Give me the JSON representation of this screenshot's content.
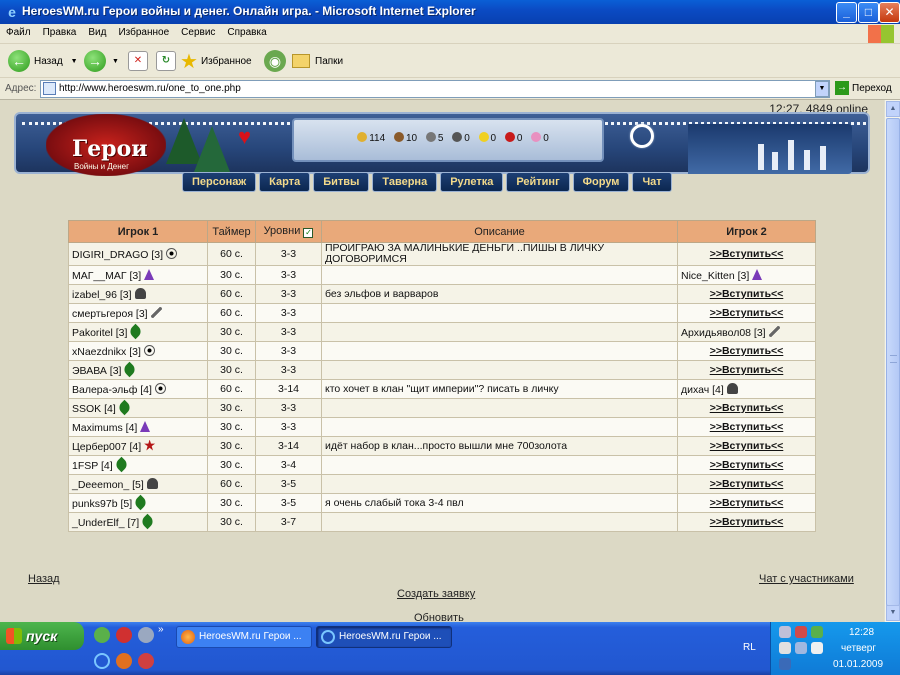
{
  "window": {
    "title": "HeroesWM.ru Герои войны и денег. Онлайн игра. - Microsoft Internet Explorer",
    "controls": {
      "minimize": "_",
      "maximize": "□",
      "close": "✕"
    }
  },
  "menu": [
    "Файл",
    "Правка",
    "Вид",
    "Избранное",
    "Сервис",
    "Справка"
  ],
  "toolbar": {
    "back": "Назад",
    "favorites": "Избранное",
    "folders": "Папки"
  },
  "address": {
    "label": "Адрес:",
    "url": "http://www.heroeswm.ru/one_to_one.php",
    "go": "Переход"
  },
  "game": {
    "online": "12:27, 4849 online",
    "logo": "Герои",
    "logo_sub": "Войны и Денег",
    "resources": [
      "114",
      "10",
      "5",
      "0",
      "0",
      "0",
      "0"
    ],
    "nav": [
      "Персонаж",
      "Карта",
      "Битвы",
      "Таверна",
      "Рулетка",
      "Рейтинг",
      "Форум",
      "Чат"
    ]
  },
  "table": {
    "headers": {
      "player1": "Игрок 1",
      "timer": "Таймер",
      "levels": "Уровни",
      "description": "Описание",
      "player2": "Игрок 2"
    },
    "join_label": ">>Вступить<<",
    "rows": [
      {
        "p1": "DIGIRI_DRAGO [3]",
        "icon": "magic",
        "timer": "60 с.",
        "levels": "3-3",
        "desc": "ПРОИГРАЮ ЗА МАЛИНЬКИЕ ДЕНЬГИ ..ПИШЫ В ЛИЧКУ ДОГОВОРИМСЯ",
        "p2": "",
        "p2icon": ""
      },
      {
        "p1": "МАГ__МАГ [3]",
        "icon": "wizard",
        "timer": "30 с.",
        "levels": "3-3",
        "desc": "",
        "p2": "Nice_Kitten [3]",
        "p2icon": "wizard"
      },
      {
        "p1": "izabel_96 [3]",
        "icon": "helm",
        "timer": "60 с.",
        "levels": "3-3",
        "desc": "без эльфов и варваров",
        "p2": "",
        "p2icon": ""
      },
      {
        "p1": "смертьгероя [3]",
        "icon": "sword",
        "timer": "60 с.",
        "levels": "3-3",
        "desc": "",
        "p2": "",
        "p2icon": ""
      },
      {
        "p1": "Pakoritel [3]",
        "icon": "leaf",
        "timer": "30 с.",
        "levels": "3-3",
        "desc": "",
        "p2": "Архидьявол08 [3]",
        "p2icon": "sword"
      },
      {
        "p1": "xNaezdnikx [3]",
        "icon": "magic",
        "timer": "30 с.",
        "levels": "3-3",
        "desc": "",
        "p2": "",
        "p2icon": ""
      },
      {
        "p1": "ЭВАВА [3]",
        "icon": "leaf",
        "timer": "30 с.",
        "levels": "3-3",
        "desc": "",
        "p2": "",
        "p2icon": ""
      },
      {
        "p1": "Валера-эльф [4]",
        "icon": "magic",
        "timer": "60 с.",
        "levels": "3-14",
        "desc": "кто хочет в клан \"щит империи\"? писать в личку",
        "p2": "дихач [4]",
        "p2icon": "helm"
      },
      {
        "p1": "SSOK [4]",
        "icon": "leaf",
        "timer": "30 с.",
        "levels": "3-3",
        "desc": "",
        "p2": "",
        "p2icon": ""
      },
      {
        "p1": "Maximums [4]",
        "icon": "wizard",
        "timer": "30 с.",
        "levels": "3-3",
        "desc": "",
        "p2": "",
        "p2icon": ""
      },
      {
        "p1": "Цербер007 [4]",
        "icon": "demon",
        "timer": "30 с.",
        "levels": "3-14",
        "desc": "идёт набор в клан...просто вышли мне 700золота",
        "p2": "",
        "p2icon": ""
      },
      {
        "p1": "1FSP [4]",
        "icon": "leaf",
        "timer": "30 с.",
        "levels": "3-4",
        "desc": "",
        "p2": "",
        "p2icon": ""
      },
      {
        "p1": "_Deeemon_ [5]",
        "icon": "helm",
        "timer": "60 с.",
        "levels": "3-5",
        "desc": "",
        "p2": "",
        "p2icon": ""
      },
      {
        "p1": "punks97b [5]",
        "icon": "leaf",
        "timer": "30 с.",
        "levels": "3-5",
        "desc": "я очень слабый тока 3-4 пвл",
        "p2": "",
        "p2icon": ""
      },
      {
        "p1": "_UnderElf_ [7]",
        "icon": "leaf",
        "timer": "30 с.",
        "levels": "3-7",
        "desc": "",
        "p2": "",
        "p2icon": ""
      }
    ]
  },
  "links": {
    "back": "Назад",
    "create": "Создать заявку",
    "chat": "Чат с участниками",
    "refresh": "Обновить"
  },
  "taskbar": {
    "start": "пуск",
    "tasks": [
      "HeroesWM.ru Герои ...",
      "HeroesWM.ru Герои ..."
    ],
    "lang": "RL",
    "time": "12:28",
    "day": "четверг",
    "date": "01.01.2009"
  }
}
